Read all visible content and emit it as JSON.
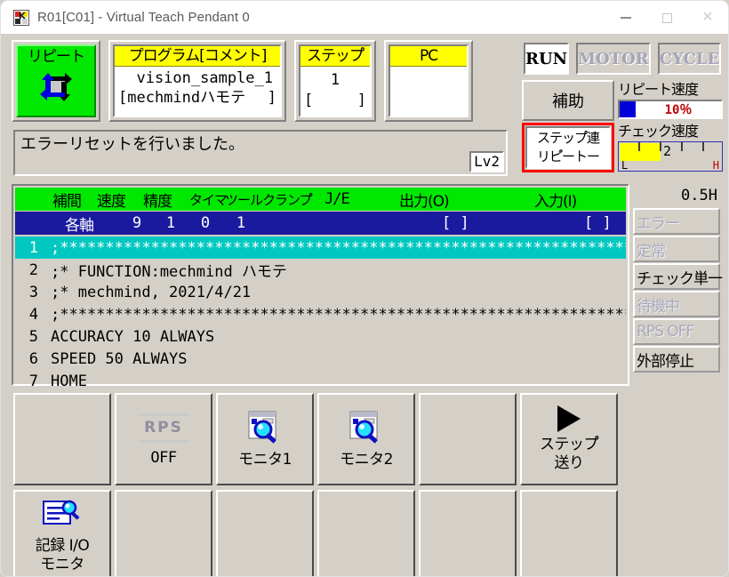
{
  "window": {
    "title": "R01[C01] - Virtual Teach Pendant 0",
    "app_icon": "kawasaki-robot-icon",
    "minimize": "—",
    "maximize": "□",
    "close": "✕"
  },
  "mode_panel": {
    "repeat_label": "リピート",
    "repeat_icon": "cycle-loop-icon"
  },
  "program_panel": {
    "caption": "プログラム[コメント]",
    "name": "vision_sample_1",
    "comment_open": "[mechmindハモテ",
    "comment_close": "]"
  },
  "step_panel": {
    "caption": "ステップ゚",
    "value": "1",
    "bracket_left": "[",
    "bracket_right": "]"
  },
  "pc_panel": {
    "caption": "PC",
    "value": ""
  },
  "mode_buttons": [
    {
      "label": "RUN",
      "active": true
    },
    {
      "label": "MOTOR",
      "active": false
    },
    {
      "label": "CYCLE",
      "active": false
    }
  ],
  "aux": {
    "label": "補助",
    "step_mode_line1": "ステップ゚連",
    "step_mode_line2": "リピ゚ートー",
    "highlight_color": "#ff0000"
  },
  "speeds": {
    "repeat_label": "リピート速度",
    "repeat_value": "10％",
    "repeat_fill_color": "#0000d8",
    "check_label": "チェック速度",
    "check_value": "2",
    "check_low": "L",
    "check_high": "H",
    "check_fill_color": "#ffff00"
  },
  "message": {
    "text": "エラーリセットを行いました。",
    "level_badge": "Lv2"
  },
  "program_list": {
    "columns": [
      "補間",
      "速度",
      "精度",
      "タイマ",
      "ツール",
      "クランプ゚",
      "J/E",
      "出力(O)",
      "入力(I)"
    ],
    "axis_row": {
      "label": "各軸",
      "values": [
        "9",
        "1",
        "0",
        "1"
      ],
      "out_field": "[                    ]",
      "in_field": "[                    ]"
    },
    "lines": [
      {
        "n": "1",
        "src": ";****************************************************************",
        "selected": true
      },
      {
        "n": "2",
        "src": ";* FUNCTION:mechmind ハモテ",
        "selected": false
      },
      {
        "n": "3",
        "src": ";* mechmind, 2021/4/21",
        "selected": false
      },
      {
        "n": "4",
        "src": ";****************************************************************",
        "selected": false
      },
      {
        "n": "5",
        "src": "ACCURACY 10 ALWAYS",
        "selected": false
      },
      {
        "n": "6",
        "src": "SPEED 50 ALWAYS",
        "selected": false
      },
      {
        "n": "7",
        "src": "HOME",
        "selected": false
      }
    ]
  },
  "clock": "0.5H",
  "status_buttons": [
    {
      "label": "エラー",
      "active": false
    },
    {
      "label": "定常",
      "active": false
    },
    {
      "label": "チェック単一",
      "active": true
    },
    {
      "label": "待機中",
      "active": false
    },
    {
      "label": "RPS OFF",
      "active": false
    },
    {
      "label": "外部停止",
      "active": true
    }
  ],
  "function_keys_top": [
    {
      "label": "",
      "sub": "",
      "icon": "",
      "dim": false
    },
    {
      "label": "RPS",
      "sub": "OFF",
      "icon": "rps-lines-icon",
      "dim": true
    },
    {
      "label": "モニタ1",
      "sub": "",
      "icon": "monitor-magnifier-icon",
      "dim": false
    },
    {
      "label": "モニタ2",
      "sub": "",
      "icon": "monitor-magnifier-icon",
      "dim": false
    },
    {
      "label": "",
      "sub": "",
      "icon": "",
      "dim": false
    },
    {
      "label": "ステップ゚",
      "sub": "送り",
      "icon": "play-triangle-icon",
      "dim": false
    }
  ],
  "function_keys_bottom": [
    {
      "label": "記録 I/O",
      "sub": "モニタ",
      "icon": "document-magnifier-icon"
    },
    {
      "label": "",
      "sub": "",
      "icon": ""
    },
    {
      "label": "",
      "sub": "",
      "icon": ""
    },
    {
      "label": "",
      "sub": "",
      "icon": ""
    },
    {
      "label": "",
      "sub": "",
      "icon": ""
    },
    {
      "label": "",
      "sub": "",
      "icon": ""
    }
  ]
}
